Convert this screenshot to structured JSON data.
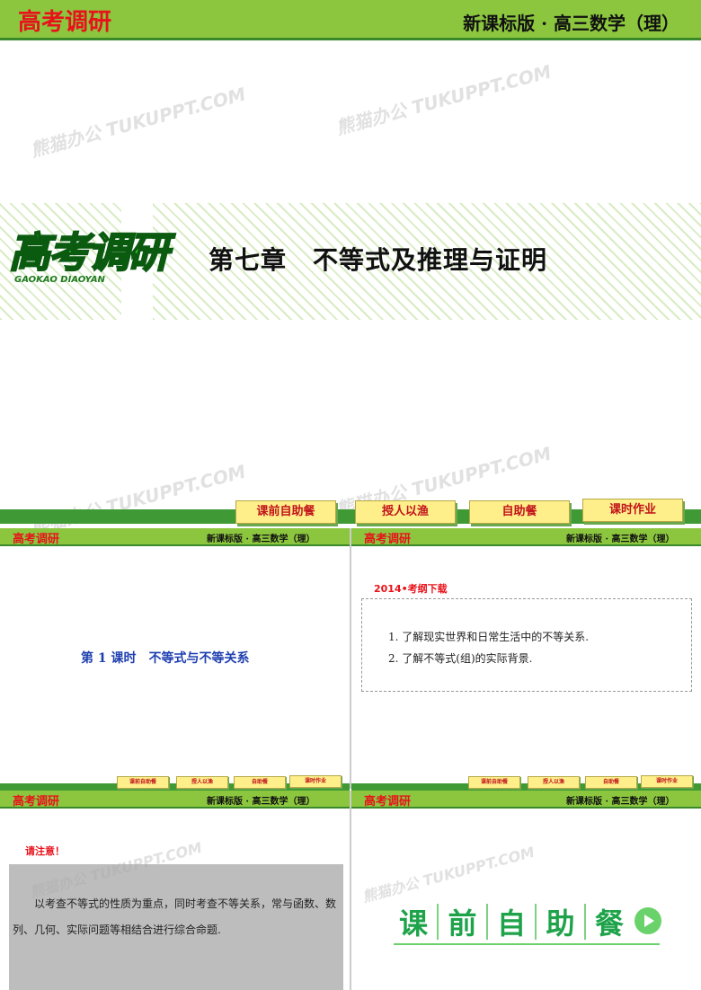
{
  "brand": "高考调研",
  "subject": "新课标版 · 高三数学（理）",
  "logo": {
    "cn": "高考调研",
    "en": "GAOKAO DIAOYAN"
  },
  "chapter": {
    "title": "第七章　不等式及推理与证明"
  },
  "nav_buttons": [
    "课前自助餐",
    "授人以渔",
    "自助餐",
    "课时作业"
  ],
  "lesson": {
    "title": "第 1 课时　不等式与不等关系"
  },
  "syllabus": {
    "heading": "2014•考纲下载",
    "items": [
      "1. 了解现实世界和日常生活中的不等关系.",
      "2. 了解不等式(组)的实际背景."
    ]
  },
  "notice": {
    "heading": "请注意！",
    "body": "以考查不等式的性质为重点，同时考查不等关系，常与函数、数列、几何、实际问题等相结合进行综合命题."
  },
  "section_banner": {
    "chars": [
      "课",
      "前",
      "自",
      "助",
      "餐"
    ]
  },
  "watermark": "熊猫办公 TUKUPPT.COM",
  "colors": {
    "bar_green": "#8cc63f",
    "dark_green": "#3f9a35",
    "brand_red": "#e8121b",
    "link_blue": "#1f3fb0",
    "button_yellow": "#ffef8a"
  }
}
